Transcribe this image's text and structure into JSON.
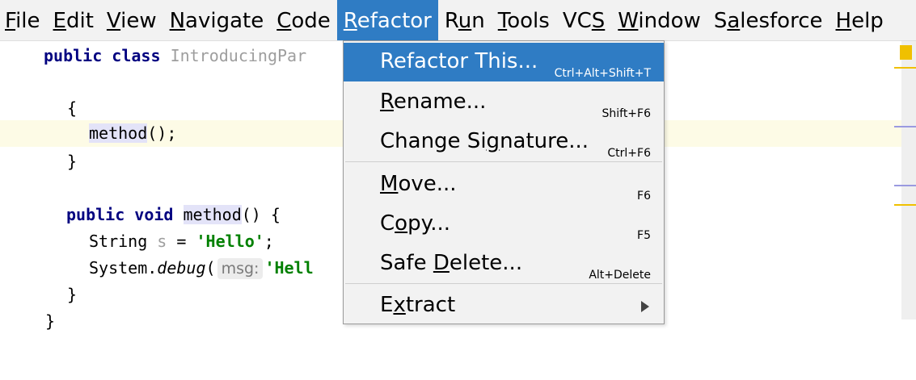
{
  "menubar": {
    "items": [
      {
        "pre": "",
        "mn": "F",
        "post": "ile"
      },
      {
        "pre": "",
        "mn": "E",
        "post": "dit"
      },
      {
        "pre": "",
        "mn": "V",
        "post": "iew"
      },
      {
        "pre": "",
        "mn": "N",
        "post": "avigate"
      },
      {
        "pre": "",
        "mn": "C",
        "post": "ode"
      },
      {
        "pre": "",
        "mn": "R",
        "post": "efactor"
      },
      {
        "pre": "R",
        "mn": "u",
        "post": "n"
      },
      {
        "pre": "",
        "mn": "T",
        "post": "ools"
      },
      {
        "pre": "VC",
        "mn": "S",
        "post": ""
      },
      {
        "pre": "",
        "mn": "W",
        "post": "indow"
      },
      {
        "pre": "S",
        "mn": "a",
        "post": "lesforce"
      },
      {
        "pre": "",
        "mn": "H",
        "post": "elp"
      }
    ]
  },
  "editor": {
    "l1_kw1": "public",
    "l1_kw2": "class",
    "l1_cls": "IntroducingPar",
    "brace_open": "{",
    "call_ident": "method",
    "call_rest": "();",
    "brace_close": "}",
    "m_kw1": "public",
    "m_kw2": "void",
    "m_ident": "method",
    "m_rest": "() {",
    "s_type": "String",
    "s_var": "s",
    "s_eq": "=",
    "s_str": "'Hello'",
    "s_end": ";",
    "d_obj": "System.",
    "d_method": "debug",
    "d_paren": "(",
    "d_hint": "msg:",
    "d_str": "'Hell",
    "d_close": "}",
    "class_close": "}"
  },
  "dropdown": {
    "items": [
      {
        "pre": "Refactor This...",
        "mn": "",
        "post": "",
        "shortcut": "Ctrl+Alt+Shift+T"
      },
      {
        "pre": "",
        "mn": "R",
        "post": "ename...",
        "shortcut": "Shift+F6"
      },
      {
        "pre": "Change Si",
        "mn": "g",
        "post": "nature...",
        "shortcut": "Ctrl+F6"
      },
      {
        "pre": "",
        "mn": "M",
        "post": "ove...",
        "shortcut": "F6"
      },
      {
        "pre": "C",
        "mn": "o",
        "post": "py...",
        "shortcut": "F5"
      },
      {
        "pre": "Safe ",
        "mn": "D",
        "post": "elete...",
        "shortcut": "Alt+Delete"
      },
      {
        "pre": "E",
        "mn": "x",
        "post": "tract",
        "shortcut": ""
      }
    ],
    "submenu_icon": "submenu-arrow-icon"
  },
  "colors": {
    "selection": "#2f7cc4",
    "keyword": "#000080",
    "string": "#008000",
    "caret_line": "#fdfbe6",
    "warning": "#f0c000"
  }
}
